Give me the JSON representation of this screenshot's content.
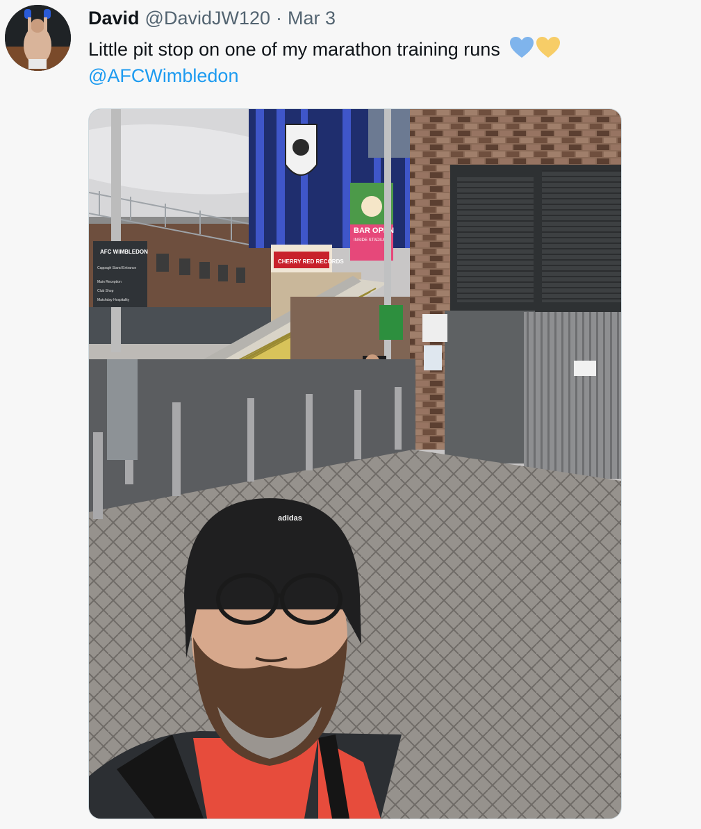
{
  "author": {
    "display_name": "David",
    "handle": "@DavidJW120",
    "separator": "·",
    "date": "Mar 3"
  },
  "tweet": {
    "text": "Little pit stop on one of my marathon training runs",
    "emoji": [
      "blue-heart",
      "yellow-heart"
    ],
    "mention": "@AFCWimbledon"
  },
  "media": {
    "image": "selfie outside stadium",
    "sign_club": "AFC WIMBLEDON",
    "sign_lines": [
      "Cappagh Stand Entrance",
      "Main Reception",
      "Club Shop",
      "Matchday Hospitality"
    ],
    "banner_lines": [
      "BAR OPEN",
      "INSIDE STADIUM"
    ],
    "stadium_sign": "CHERRY RED RECORDS",
    "hat_brand": "adidas"
  },
  "colors": {
    "link": "#1d9bf0",
    "text": "#0f1419",
    "muted": "#536471",
    "background": "#f7f7f7"
  }
}
